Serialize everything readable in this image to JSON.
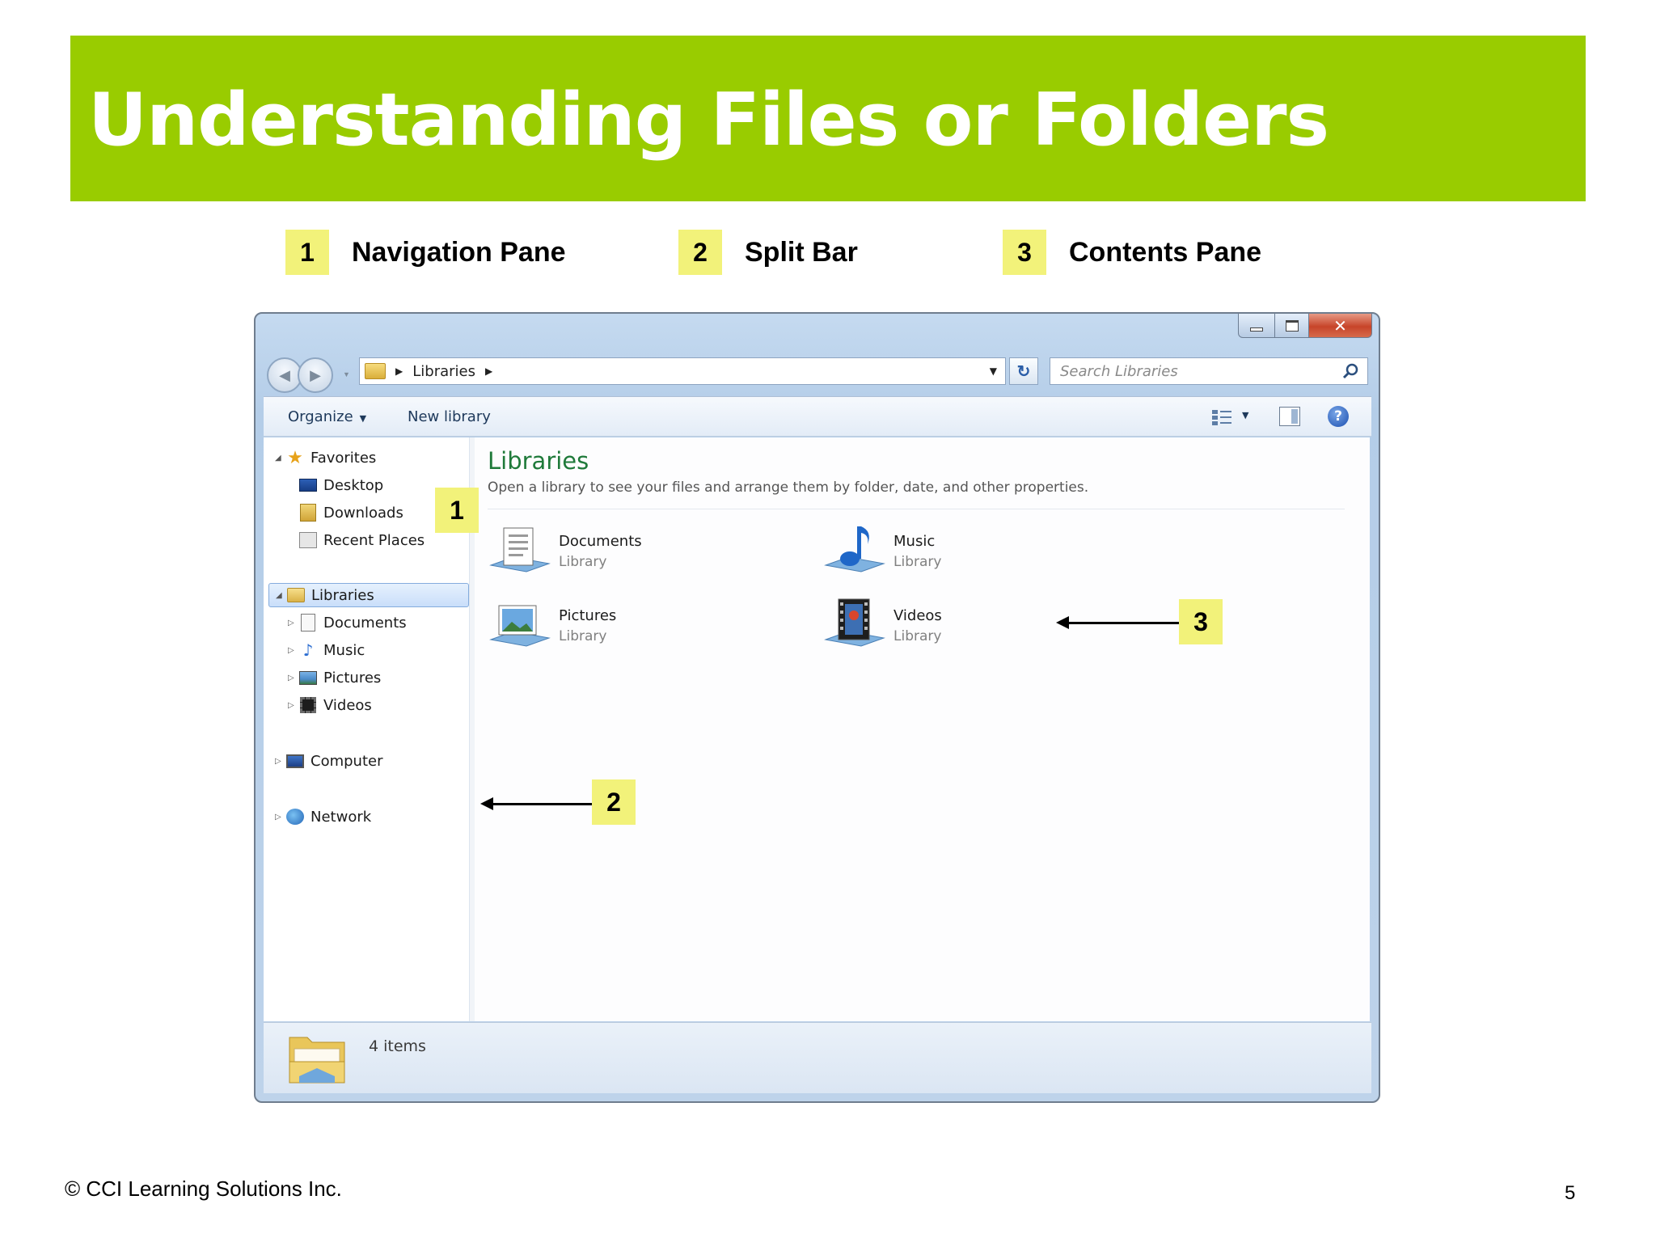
{
  "slide": {
    "title": "Understanding Files or Folders",
    "header_color": "#99cc00",
    "badge_color": "#f2f27a"
  },
  "legend": [
    {
      "number": "1",
      "label": "Navigation Pane"
    },
    {
      "number": "2",
      "label": "Split Bar"
    },
    {
      "number": "3",
      "label": "Contents Pane"
    }
  ],
  "window": {
    "close_glyph": "✕",
    "address": {
      "crumb": "Libraries"
    },
    "search_placeholder": "Search Libraries",
    "toolbar": {
      "organize": "Organize",
      "new_library": "New library",
      "help_glyph": "?"
    },
    "nav": {
      "favorites": "Favorites",
      "desktop": "Desktop",
      "downloads": "Downloads",
      "recent_places": "Recent Places",
      "libraries": "Libraries",
      "documents": "Documents",
      "music": "Music",
      "pictures": "Pictures",
      "videos": "Videos",
      "computer": "Computer",
      "network": "Network"
    },
    "contents": {
      "title": "Libraries",
      "subtitle": "Open a library to see your files and arrange them by folder, date, and other properties.",
      "items": [
        {
          "name": "Documents",
          "type": "Library",
          "icon": "documents-library-icon"
        },
        {
          "name": "Music",
          "type": "Library",
          "icon": "music-library-icon"
        },
        {
          "name": "Pictures",
          "type": "Library",
          "icon": "pictures-library-icon"
        },
        {
          "name": "Videos",
          "type": "Library",
          "icon": "videos-library-icon"
        }
      ]
    },
    "status": {
      "text": "4 items"
    }
  },
  "callouts": {
    "nav": "1",
    "split": "2",
    "contents": "3"
  },
  "footer": {
    "copyright": "© CCI Learning Solutions Inc.",
    "page_number": "5"
  }
}
